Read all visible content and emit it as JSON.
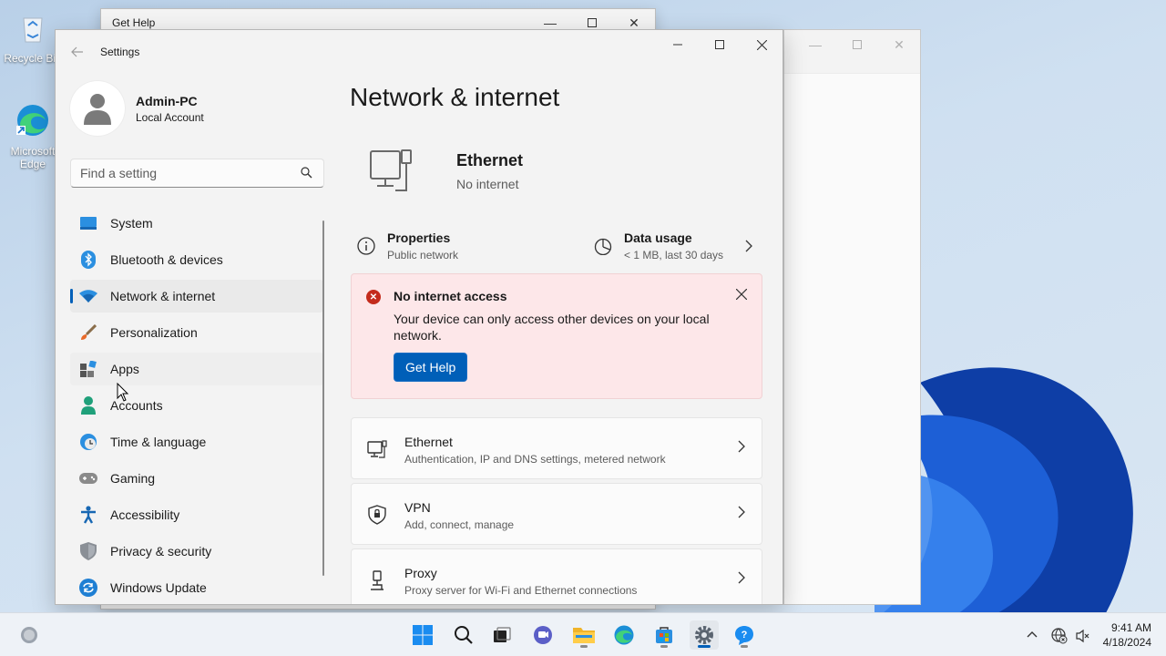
{
  "desktop": {
    "icons": [
      {
        "label": "Recycle Bin",
        "icon": "recycle-bin-icon"
      },
      {
        "label": "Microsoft Edge",
        "icon": "edge-icon"
      }
    ]
  },
  "get_help_window": {
    "title": "Get Help"
  },
  "settings": {
    "title": "Settings",
    "profile": {
      "name": "Admin-PC",
      "account_type": "Local Account"
    },
    "search": {
      "placeholder": "Find a setting"
    },
    "nav": [
      {
        "label": "System",
        "icon": "system-icon"
      },
      {
        "label": "Bluetooth & devices",
        "icon": "bluetooth-icon"
      },
      {
        "label": "Network & internet",
        "icon": "wifi-icon",
        "selected": true
      },
      {
        "label": "Personalization",
        "icon": "brush-icon"
      },
      {
        "label": "Apps",
        "icon": "apps-icon"
      },
      {
        "label": "Accounts",
        "icon": "accounts-icon"
      },
      {
        "label": "Time & language",
        "icon": "clock-globe-icon"
      },
      {
        "label": "Gaming",
        "icon": "gamepad-icon"
      },
      {
        "label": "Accessibility",
        "icon": "accessibility-icon"
      },
      {
        "label": "Privacy & security",
        "icon": "shield-icon"
      },
      {
        "label": "Windows Update",
        "icon": "update-icon"
      }
    ],
    "page_title": "Network & internet",
    "connection": {
      "name": "Ethernet",
      "status": "No internet"
    },
    "properties": {
      "title": "Properties",
      "subtitle": "Public network"
    },
    "data_usage": {
      "title": "Data usage",
      "subtitle": "< 1 MB, last 30 days"
    },
    "alert": {
      "title": "No internet access",
      "message": "Your device can only access other devices on your local network.",
      "button": "Get Help"
    },
    "cards": [
      {
        "title": "Ethernet",
        "subtitle": "Authentication, IP and DNS settings, metered network",
        "icon": "ethernet-icon"
      },
      {
        "title": "VPN",
        "subtitle": "Add, connect, manage",
        "icon": "vpn-shield-icon"
      },
      {
        "title": "Proxy",
        "subtitle": "Proxy server for Wi-Fi and Ethernet connections",
        "icon": "proxy-icon"
      }
    ]
  },
  "taskbar": {
    "apps": [
      "start",
      "search",
      "task-view",
      "teams",
      "file-explorer",
      "edge",
      "store",
      "settings",
      "get-help"
    ],
    "clock": {
      "time": "9:41 AM",
      "date": "4/18/2024"
    }
  },
  "colors": {
    "accent": "#005fb8",
    "alert_bg": "#fde7e9",
    "error": "#c42b1c"
  }
}
